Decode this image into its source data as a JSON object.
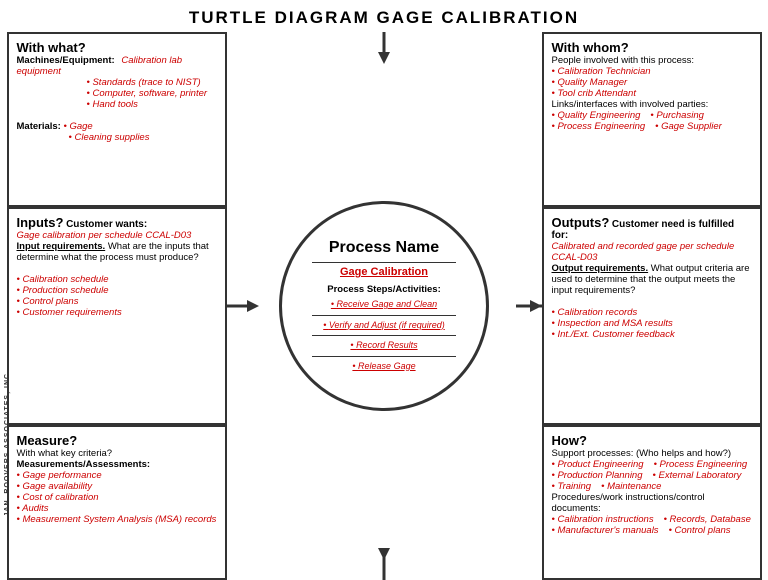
{
  "title": "TURTLE DIAGRAM GAGE CALIBRATION",
  "with_what": {
    "heading": "With what?",
    "machines_label": "Machines/Equipment:",
    "machines_items": [
      "Calibration lab equipment",
      "Standards (trace to NIST)",
      "Computer, software, printer",
      "Hand tools"
    ],
    "materials_label": "Materials:",
    "materials_items": [
      "Gage",
      "Cleaning supplies"
    ]
  },
  "with_whom": {
    "heading": "With whom?",
    "people_label": "People involved with this process:",
    "people_items": [
      "Calibration Technician",
      "Quality Manager",
      "Tool crib Attendant"
    ],
    "links_label": "Links/interfaces with involved parties:",
    "links_items": [
      [
        "Quality Engineering",
        "Purchasing"
      ],
      [
        "Process Engineering",
        "Gage Supplier"
      ]
    ]
  },
  "inputs": {
    "heading": "Inputs?",
    "customer_label": "Customer wants:",
    "customer_value": "Gage calibration per schedule CCAL-D03",
    "input_req_label": "Input requirements.",
    "input_req_text": "What are the inputs that determine what the process must produce?",
    "items": [
      "Calibration schedule",
      "Production schedule",
      "Control plans",
      "Customer requirements"
    ]
  },
  "outputs": {
    "heading": "Outputs?",
    "customer_label": "Customer need is fulfilled for:",
    "customer_value": "Calibrated and recorded gage per schedule CCAL-D03",
    "output_req_label": "Output requirements.",
    "output_req_text": "What output criteria are used to determine that the output meets the input requirements?",
    "items": [
      "Calibration records",
      "Inspection and MSA results",
      "Int./Ext. Customer feedback"
    ]
  },
  "measure": {
    "heading": "Measure?",
    "sub_label": "With what key criteria?",
    "assessments_label": "Measurements/Assessments:",
    "items": [
      "Gage performance",
      "Gage availability",
      "Cost of calibration",
      "Audits",
      "Measurement System Analysis  (MSA) records"
    ]
  },
  "how": {
    "heading": "How?",
    "support_label": "Support processes:",
    "who_helps_label": "(Who helps and how?)",
    "support_items": [
      [
        "Product Engineering",
        "Process Engineering"
      ],
      [
        "Production Planning",
        "External Laboratory"
      ],
      [
        "Training",
        "Maintenance"
      ]
    ],
    "procedures_label": "Procedures/work instructions/control documents:",
    "procedure_items": [
      [
        "Calibration instructions",
        "Records, Database"
      ],
      [
        "Manufacturer's manuals",
        "Control plans"
      ]
    ]
  },
  "process": {
    "name_label": "Process Name",
    "gage_label": "Gage Calibration",
    "steps_label": "Process Steps/Activities:",
    "steps": [
      "Receive Gage and Clean",
      "Verify and Adjust (if required)",
      "Record Results",
      "Release Gage"
    ]
  },
  "side_text": "JAN. ROOVERS ASSOCIATES, INC."
}
